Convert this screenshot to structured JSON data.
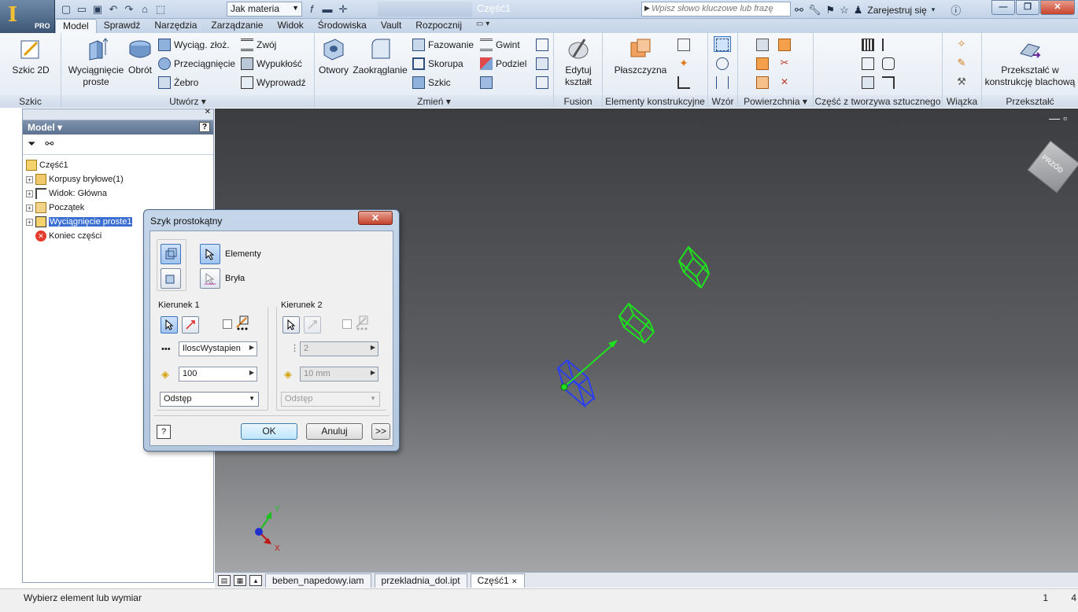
{
  "titlebar": {
    "material": "Jak materia",
    "doc_title": "Część1",
    "search_placeholder": "Wpisz słowo kluczowe lub frazę",
    "signin": "Zarejestruj się",
    "app_edition": "PRO"
  },
  "tabs": [
    "Model",
    "Sprawdź",
    "Narzędzia",
    "Zarządzanie",
    "Widok",
    "Środowiska",
    "Vault",
    "Rozpocznij"
  ],
  "ribbon": {
    "szkic": {
      "btn": "Szkic 2D",
      "title": "Szkic"
    },
    "utworz": {
      "extrude": "Wyciągnięcie proste",
      "revolve": "Obrót",
      "loft": "Wyciąg. złoż.",
      "sweep": "Przeciągnięcie",
      "rib": "Żebro",
      "coil": "Zwój",
      "emboss": "Wypukłość",
      "derive": "Wyprowadź",
      "title": "Utwórz ▾"
    },
    "zmien": {
      "hole": "Otwory",
      "fillet": "Zaokrąglanie",
      "chamfer": "Fazowanie",
      "shell": "Skorupa",
      "sketch": "Szkic",
      "thread": "Gwint",
      "split": "Podziel",
      "title": "Zmień ▾"
    },
    "fusion": {
      "btn": "Edytuj kształt",
      "title": "Fusion"
    },
    "work": {
      "btn": "Płaszczyzna",
      "title": "Elementy konstrukcyjne"
    },
    "pattern": {
      "title": "Wzór"
    },
    "surface": {
      "title": "Powierzchnia ▾"
    },
    "plastic": {
      "title": "Część z tworzywa sztucznego"
    },
    "harness": {
      "title": "Wiązka"
    },
    "convert": {
      "btn": "Przekształć w konstrukcję blachową",
      "title": "Przekształć"
    }
  },
  "browser": {
    "title": "Model ▾",
    "tree": [
      {
        "label": "Część1",
        "level": 0
      },
      {
        "label": "Korpusy bryłowe(1)",
        "level": 1
      },
      {
        "label": "Widok: Główna",
        "level": 1
      },
      {
        "label": "Początek",
        "level": 1
      },
      {
        "label": "Wyciągnięcie proste1",
        "level": 1
      },
      {
        "label": "Koniec części",
        "level": 1
      }
    ]
  },
  "dialog": {
    "title": "Szyk prostokątny",
    "elements_label": "Elementy",
    "body_label": "Bryła",
    "dir1_label": "Kierunek 1",
    "dir2_label": "Kierunek 2",
    "dir1_count": "IloscWystapien",
    "dir1_spacing": "100",
    "dir1_mode": "Odstęp",
    "dir2_count": "2",
    "dir2_spacing": "10 mm",
    "dir2_mode": "Odstęp",
    "ok": "OK",
    "cancel": "Anuluj",
    "more": ">>",
    "help": "?"
  },
  "doctabs": [
    "beben_napedowy.iam",
    "przekladnia_dol.ipt",
    "Część1"
  ],
  "status": {
    "text": "Wybierz element lub wymiar",
    "num": "1",
    "num2": "4"
  },
  "viewcube": {
    "face": "PRZÓD"
  },
  "axes": {
    "x": "X",
    "y": "Y"
  },
  "colors": {
    "accent": "#3a6ed3",
    "preview": "#1fe01f",
    "selected": "#2840e0",
    "annotation": "#d81414"
  }
}
